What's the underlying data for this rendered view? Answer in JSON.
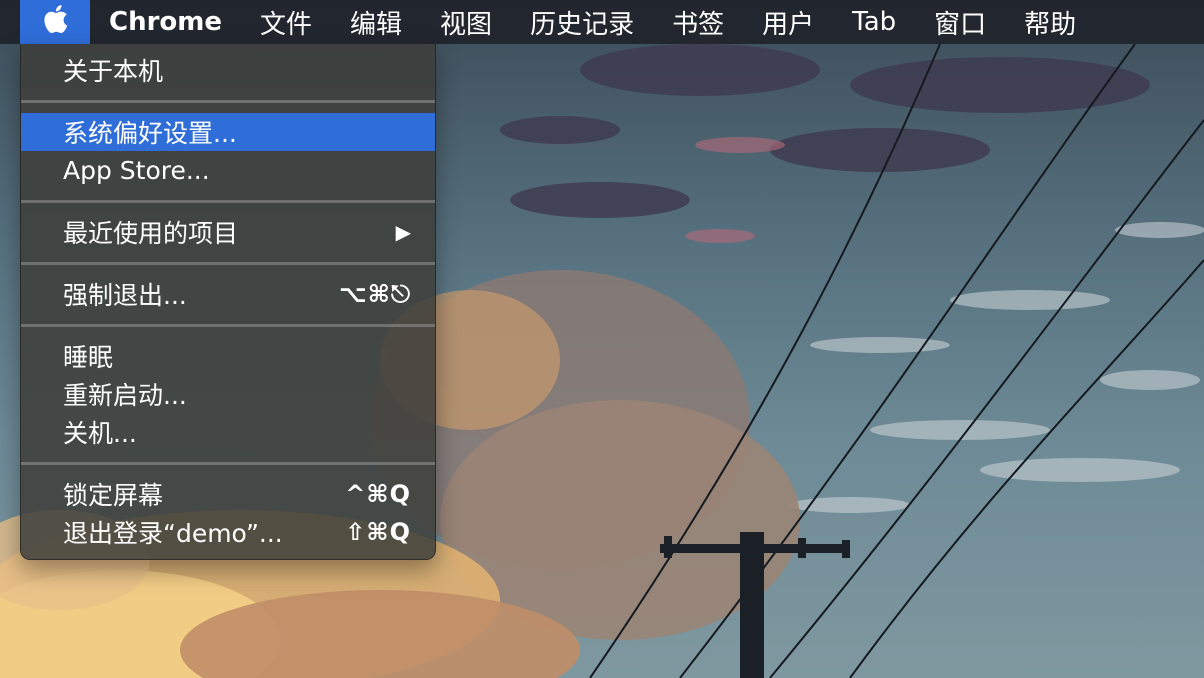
{
  "menubar": {
    "apple_icon": "apple-logo-icon",
    "app_name": "Chrome",
    "items": [
      "文件",
      "编辑",
      "视图",
      "历史记录",
      "书签",
      "用户",
      "Tab",
      "窗口",
      "帮助"
    ]
  },
  "apple_menu": {
    "about": "关于本机",
    "system_prefs": "系统偏好设置...",
    "app_store": "App Store...",
    "recent_items": "最近使用的项目",
    "recent_arrow": "▶",
    "force_quit": "强制退出...",
    "force_quit_shortcut": "⌥⌘⎋",
    "sleep": "睡眠",
    "restart": "重新启动...",
    "shutdown": "关机...",
    "lock_screen": "锁定屏幕",
    "lock_screen_shortcut": "^⌘Q",
    "logout": "退出登录“demo”...",
    "logout_shortcut": "⇧⌘Q"
  },
  "colors": {
    "highlight": "#2f6dd9",
    "menubar_bg": "#20232a"
  }
}
